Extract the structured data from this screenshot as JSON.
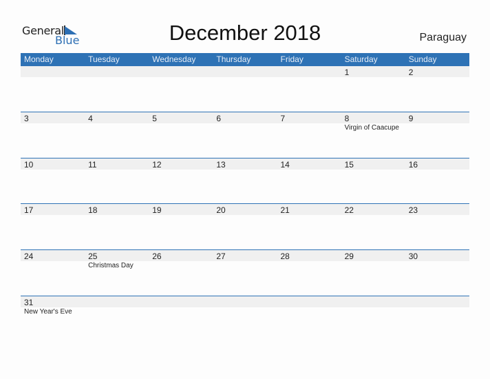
{
  "logo": {
    "word1": "General",
    "word2": "Blue"
  },
  "title": "December 2018",
  "country": "Paraguay",
  "colors": {
    "accent": "#2e72b5",
    "band": "#f0f0f0"
  },
  "weekdays": [
    "Monday",
    "Tuesday",
    "Wednesday",
    "Thursday",
    "Friday",
    "Saturday",
    "Sunday"
  ],
  "weeks": [
    {
      "days": [
        {
          "num": "",
          "event": ""
        },
        {
          "num": "",
          "event": ""
        },
        {
          "num": "",
          "event": ""
        },
        {
          "num": "",
          "event": ""
        },
        {
          "num": "",
          "event": ""
        },
        {
          "num": "1",
          "event": ""
        },
        {
          "num": "2",
          "event": ""
        }
      ]
    },
    {
      "days": [
        {
          "num": "3",
          "event": ""
        },
        {
          "num": "4",
          "event": ""
        },
        {
          "num": "5",
          "event": ""
        },
        {
          "num": "6",
          "event": ""
        },
        {
          "num": "7",
          "event": ""
        },
        {
          "num": "8",
          "event": "Virgin of Caacupe"
        },
        {
          "num": "9",
          "event": ""
        }
      ]
    },
    {
      "days": [
        {
          "num": "10",
          "event": ""
        },
        {
          "num": "11",
          "event": ""
        },
        {
          "num": "12",
          "event": ""
        },
        {
          "num": "13",
          "event": ""
        },
        {
          "num": "14",
          "event": ""
        },
        {
          "num": "15",
          "event": ""
        },
        {
          "num": "16",
          "event": ""
        }
      ]
    },
    {
      "days": [
        {
          "num": "17",
          "event": ""
        },
        {
          "num": "18",
          "event": ""
        },
        {
          "num": "19",
          "event": ""
        },
        {
          "num": "20",
          "event": ""
        },
        {
          "num": "21",
          "event": ""
        },
        {
          "num": "22",
          "event": ""
        },
        {
          "num": "23",
          "event": ""
        }
      ]
    },
    {
      "days": [
        {
          "num": "24",
          "event": ""
        },
        {
          "num": "25",
          "event": "Christmas Day"
        },
        {
          "num": "26",
          "event": ""
        },
        {
          "num": "27",
          "event": ""
        },
        {
          "num": "28",
          "event": ""
        },
        {
          "num": "29",
          "event": ""
        },
        {
          "num": "30",
          "event": ""
        }
      ]
    },
    {
      "days": [
        {
          "num": "31",
          "event": "New Year's Eve"
        },
        {
          "num": "",
          "event": ""
        },
        {
          "num": "",
          "event": ""
        },
        {
          "num": "",
          "event": ""
        },
        {
          "num": "",
          "event": ""
        },
        {
          "num": "",
          "event": ""
        },
        {
          "num": "",
          "event": ""
        }
      ]
    }
  ]
}
